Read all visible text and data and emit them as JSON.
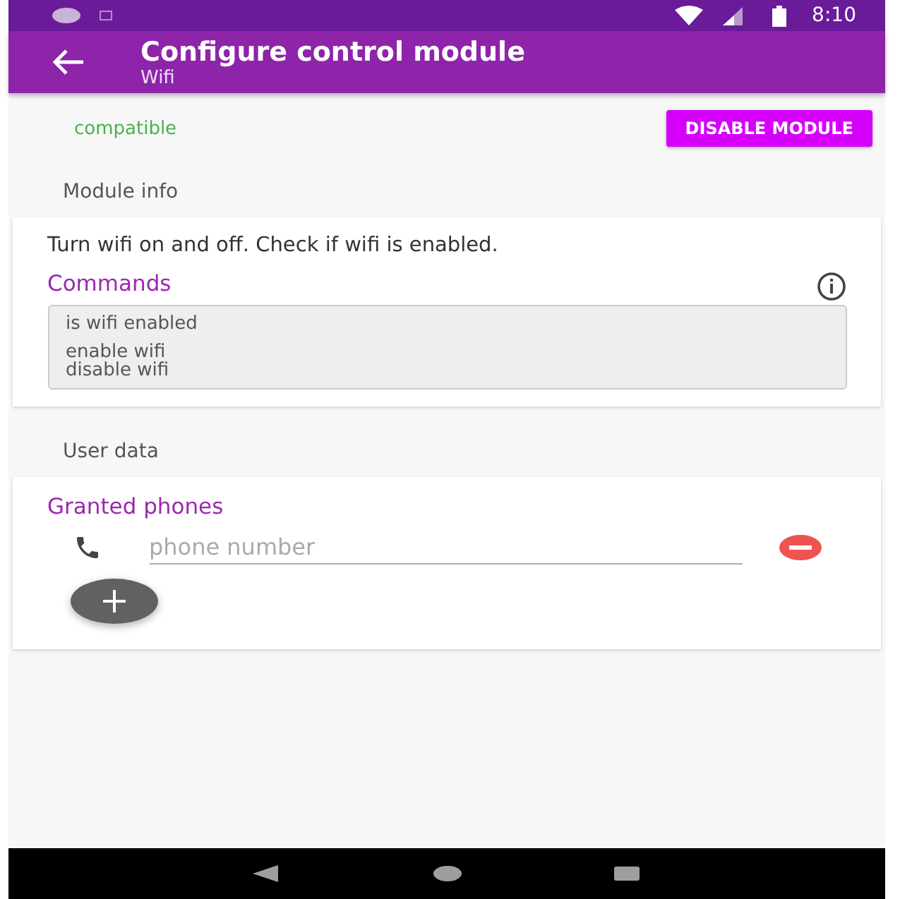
{
  "status_bar": {
    "time": "8:10"
  },
  "app_bar": {
    "title": "Configure control module",
    "subtitle": "Wifi"
  },
  "module": {
    "status": "compatible",
    "action": "DISABLE MODULE"
  },
  "module_info": {
    "heading": "Module info",
    "description": "Turn wifi on and off. Check if wifi is enabled.",
    "commands_label": "Commands",
    "command_groups": [
      [
        "is wifi enabled"
      ],
      [
        "enable wifi",
        "disable wifi"
      ]
    ]
  },
  "user_data": {
    "heading": "User data",
    "label": "Granted phones",
    "phones": [
      {
        "placeholder": "phone number"
      }
    ]
  }
}
